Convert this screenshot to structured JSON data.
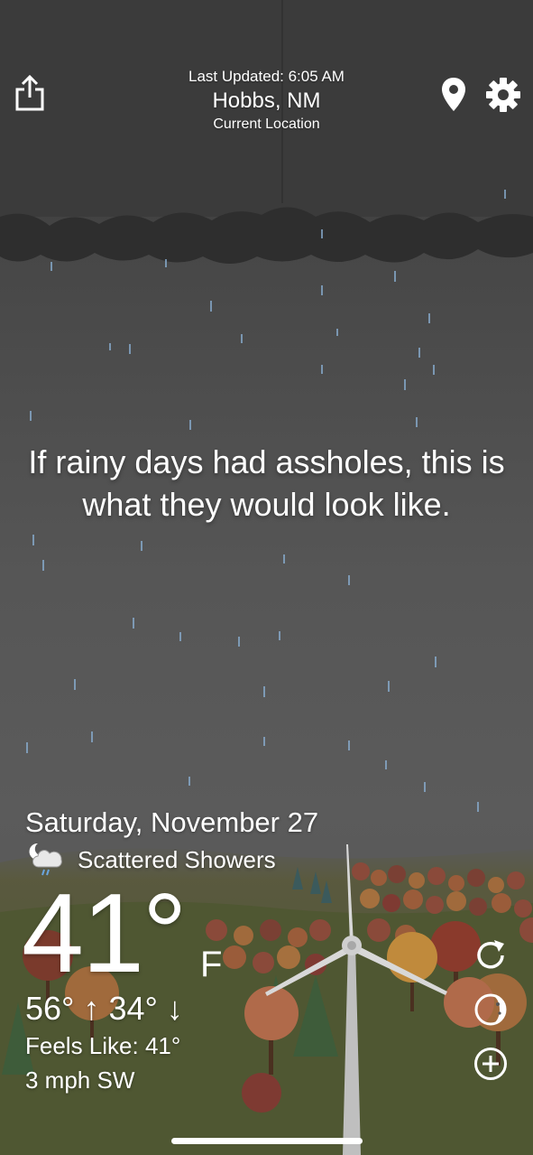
{
  "header": {
    "last_updated": "Last Updated: 6:05 AM",
    "city": "Hobbs, NM",
    "location_label": "Current Location",
    "share_icon": "share-icon",
    "location_icon": "map-pin-icon",
    "settings_icon": "gear-icon"
  },
  "message": "If rainy days had assholes, this is what they would look like.",
  "weather": {
    "date": "Saturday, November 27",
    "condition": "Scattered Showers",
    "condition_icon": "moon-cloud-rain-icon",
    "temperature": "41°",
    "unit": "F",
    "hi_lo": "56° ↑ 34° ↓",
    "feels_like": "Feels Like: 41°",
    "wind": "3 mph SW"
  },
  "actions": {
    "refresh_icon": "refresh-icon",
    "moon_phase_icon": "moon-phase-icon",
    "add_icon": "plus-circle-icon"
  },
  "colors": {
    "sky_top": "#3a3a3a",
    "sky_bottom": "#5b5b5b",
    "rain": "#8ab0d4",
    "hills": "#5c6236",
    "text": "#ffffff"
  }
}
